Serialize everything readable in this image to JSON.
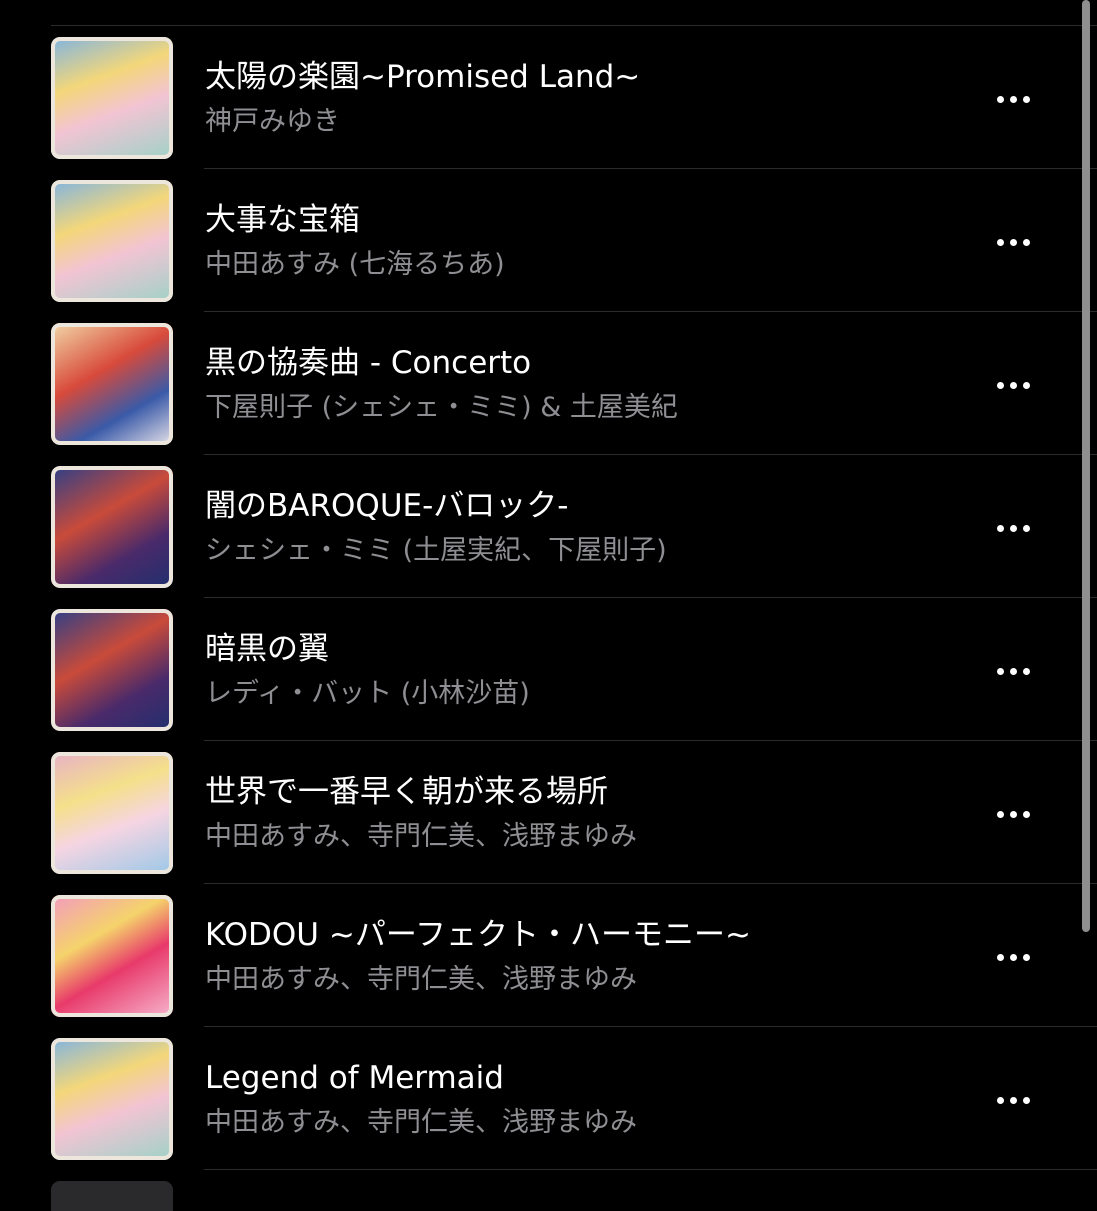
{
  "tracks": [
    {
      "title": "太陽の楽園~Promised Land~",
      "artist": "神戸みゆき",
      "art": {
        "bg": "linear-gradient(160deg,#7fb3e3 0%,#f3d77a 35%,#f2c4d3 60%,#9fd2c7 100%)"
      }
    },
    {
      "title": "大事な宝箱",
      "artist": "中田あすみ (七海るちあ)",
      "art": {
        "bg": "linear-gradient(160deg,#7fb3e3 0%,#f3d77a 35%,#f2c4d3 60%,#9fd2c7 100%)"
      }
    },
    {
      "title": "黒の協奏曲 - Concerto",
      "artist": "下屋則子 (シェシェ・ミミ) & 土屋美紀",
      "art": {
        "bg": "linear-gradient(150deg,#f2d9a8 0%,#d84a3b 40%,#3a5aa8 70%,#e8e4ea 100%)"
      }
    },
    {
      "title": "闇のBAROQUE-バロック-",
      "artist": "シェシェ・ミミ (土屋実紀、下屋則子)",
      "art": {
        "bg": "linear-gradient(150deg,#2a3f8a 0%,#c94b3a 40%,#4a2a6a 70%,#1f2f6f 100%)"
      }
    },
    {
      "title": "暗黒の翼",
      "artist": "レディ・バット (小林沙苗)",
      "art": {
        "bg": "linear-gradient(150deg,#2a3f8a 0%,#c94b3a 40%,#4a2a6a 70%,#1f2f6f 100%)"
      }
    },
    {
      "title": "世界で一番早く朝が来る場所",
      "artist": "中田あすみ、寺門仁美、浅野まゆみ",
      "art": {
        "bg": "linear-gradient(160deg,#e7b0c8 0%,#f4e08a 35%,#f6d5e2 60%,#9ac8e8 100%)"
      }
    },
    {
      "title": "KODOU ~パーフェクト・ハーモニー~",
      "artist": "中田あすみ、寺門仁美、浅野まゆみ",
      "art": {
        "bg": "linear-gradient(150deg,#f29ac0 0%,#f5d36b 35%,#e83a6a 60%,#f7b6cf 100%)"
      }
    },
    {
      "title": "Legend of Mermaid",
      "artist": "中田あすみ、寺門仁美、浅野まゆみ",
      "art": {
        "bg": "linear-gradient(160deg,#7fb3e3 0%,#f3d77a 35%,#f2c4d3 60%,#9fd2c7 100%)"
      }
    }
  ],
  "colors": {
    "background": "#000000",
    "title": "#ffffff",
    "subtitle": "#8e8e93",
    "divider": "#2b2b2b",
    "scrollbar": "#8f8f8f"
  },
  "icons": {
    "more": "ellipsis-horizontal-icon"
  }
}
